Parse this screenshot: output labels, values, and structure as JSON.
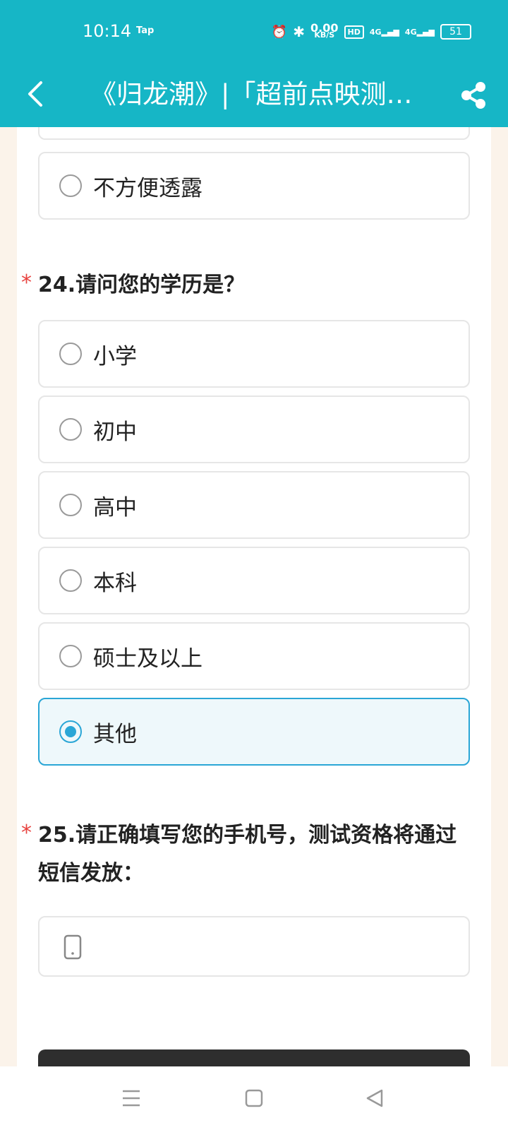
{
  "status_bar": {
    "time": "10:14",
    "app_badge": "Tap",
    "speed_value": "0.00",
    "speed_unit": "KB/S",
    "hd_label": "HD",
    "net1": "4G",
    "net2": "4G",
    "battery": "51"
  },
  "nav": {
    "title": "《归龙潮》|「超前点映测试」招募问卷"
  },
  "q23": {
    "last_option": "不方便透露"
  },
  "q24": {
    "required_mark": "*",
    "question": "24.请问您的学历是？",
    "options": [
      "小学",
      "初中",
      "高中",
      "本科",
      "硕士及以上",
      "其他"
    ],
    "selected": "其他"
  },
  "q25": {
    "required_mark": "*",
    "question": "25.请正确填写您的手机号，测试资格将通过短信发放：",
    "value": "",
    "placeholder": ""
  },
  "colors": {
    "header": "#16b6c6",
    "accent": "#2aa6d6",
    "required": "#e8423f"
  }
}
